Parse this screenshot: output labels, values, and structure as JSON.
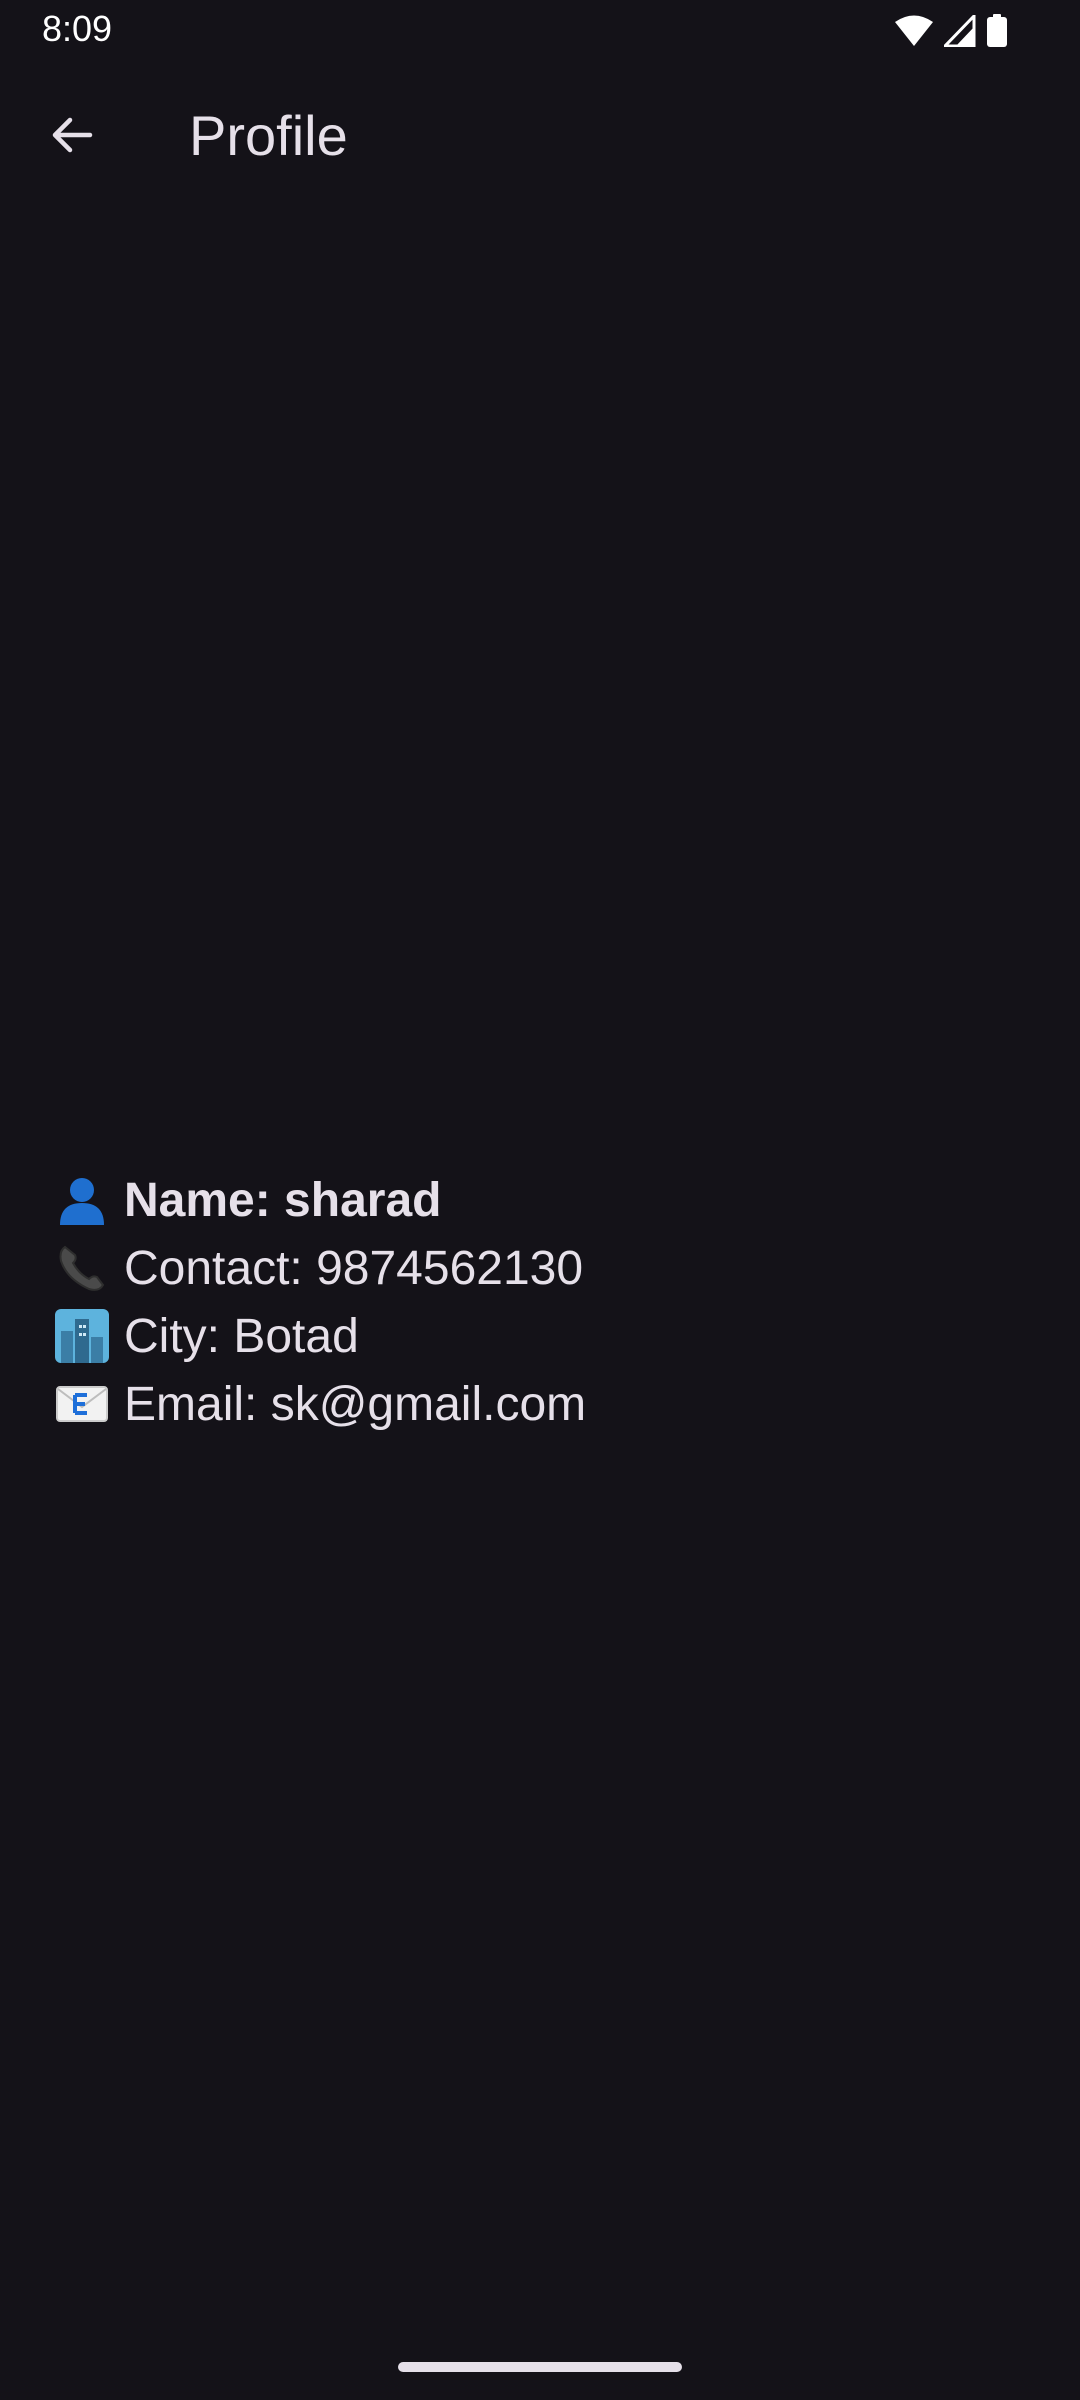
{
  "status_bar": {
    "time": "8:09",
    "icons": [
      "wifi-icon",
      "signal-icon",
      "battery-icon"
    ]
  },
  "app_bar": {
    "back_icon": "arrow-back-icon",
    "title": "Profile"
  },
  "profile": {
    "name_label": "Name: sharad",
    "contact_label": "Contact: 9874562130",
    "city_label": "City: Botad",
    "email_label": "Email: sk@gmail.com",
    "icons": {
      "name": "person-icon",
      "contact": "phone-icon",
      "city": "cityscape-icon",
      "email": "envelope-icon"
    }
  },
  "colors": {
    "background": "#141218",
    "text": "#e6e0e9"
  }
}
